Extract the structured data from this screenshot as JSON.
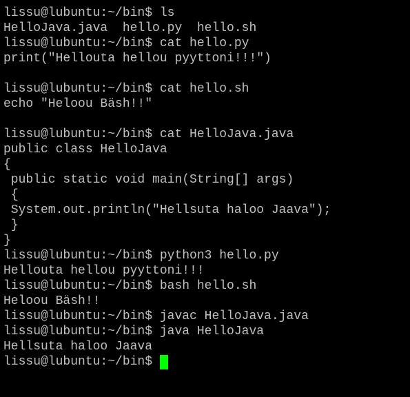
{
  "terminal": {
    "lines": [
      "lissu@lubuntu:~/bin$ ls",
      "HelloJava.java  hello.py  hello.sh",
      "lissu@lubuntu:~/bin$ cat hello.py",
      "print(\"Hellouta hellou pyyttoni!!!\")",
      "",
      "lissu@lubuntu:~/bin$ cat hello.sh",
      "echo \"Heloou Bäsh!!\"",
      "",
      "lissu@lubuntu:~/bin$ cat HelloJava.java",
      "public class HelloJava",
      "{",
      " public static void main(String[] args)",
      " {",
      " System.out.println(\"Hellsuta haloo Jaava\");",
      " }",
      "}",
      "lissu@lubuntu:~/bin$ python3 hello.py",
      "Hellouta hellou pyyttoni!!!",
      "lissu@lubuntu:~/bin$ bash hello.sh",
      "Heloou Bäsh!!",
      "lissu@lubuntu:~/bin$ javac HelloJava.java",
      "lissu@lubuntu:~/bin$ java HelloJava",
      "Hellsuta haloo Jaava"
    ],
    "prompt": "lissu@lubuntu:~/bin$ ",
    "colors": {
      "background": "#000000",
      "foreground": "#c0c0c0",
      "cursor": "#00ff00"
    }
  }
}
